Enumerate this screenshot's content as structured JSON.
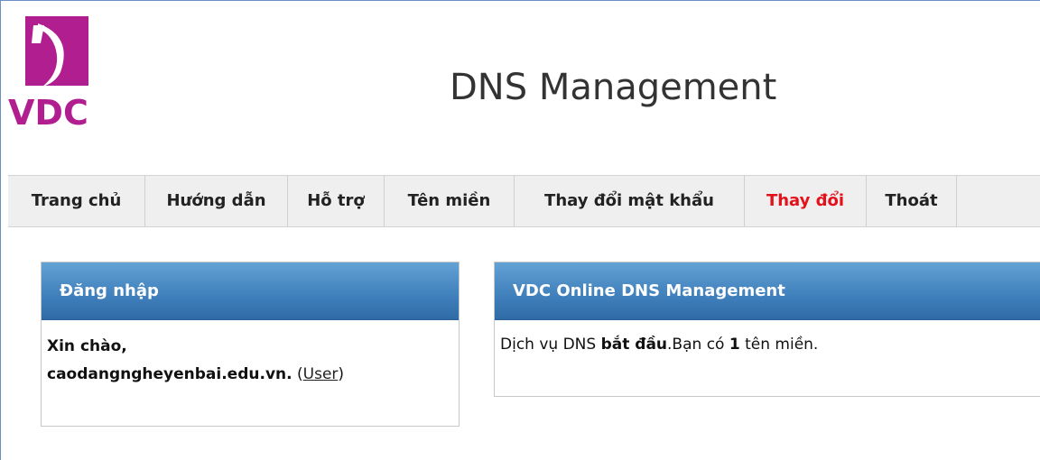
{
  "logo": {
    "text": "VDC",
    "brand_color": "#b01e8f"
  },
  "page": {
    "title": "DNS Management"
  },
  "nav": {
    "items": [
      {
        "label": "Trang chủ"
      },
      {
        "label": "Hướng dẫn"
      },
      {
        "label": "Hỗ trợ"
      },
      {
        "label": "Tên miền"
      },
      {
        "label": "Thay đổi mật khẩu"
      },
      {
        "label": "Thay đổi"
      },
      {
        "label": "Thoát"
      }
    ],
    "active_color": "#e4101a"
  },
  "login_panel": {
    "title": "Đăng nhập",
    "greeting": "Xin chào,",
    "domain": "caodangngheyenbai.edu.vn.",
    "role_open": "(",
    "role_link": "User",
    "role_close": ")"
  },
  "info_panel": {
    "title": "VDC Online DNS Management",
    "text_prefix": "Dịch vụ DNS ",
    "status": "bắt đầu",
    "text_middle": ".Bạn có ",
    "count": "1",
    "text_suffix": " tên miền."
  }
}
